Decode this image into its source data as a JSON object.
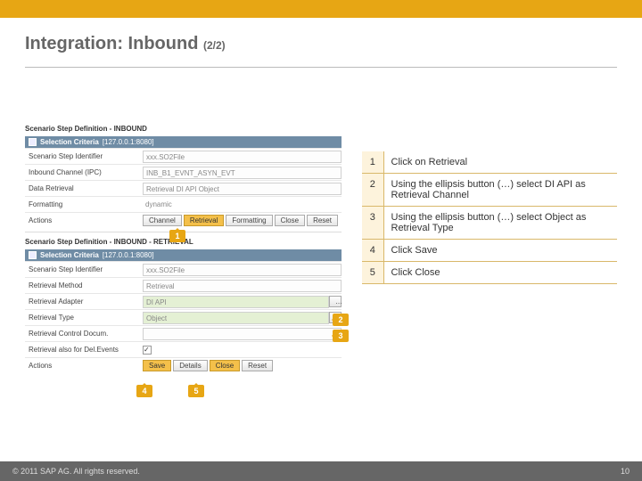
{
  "title_main": "Integration: Inbound",
  "title_sub": "(2/2)",
  "panel1": {
    "head": "Scenario Step Definition - INBOUND",
    "sel_label": "Selection Criteria",
    "sel_ip": "[127.0.0.1:8080]",
    "r_identifier_lbl": "Scenario Step Identifier",
    "r_identifier_val": "xxx.SO2File",
    "r_channel_lbl": "Inbound Channel (IPC)",
    "r_channel_val": "INB_B1_EVNT_ASYN_EVT",
    "r_retrieval_lbl": "Data Retrieval",
    "r_retrieval_val": "Retrieval DI API Object",
    "r_format_lbl": "Formatting",
    "r_format_val": "dynamic",
    "actions_lbl": "Actions",
    "btn_channel": "Channel",
    "btn_retrieval": "Retrieval",
    "btn_formatting": "Formatting",
    "btn_close": "Close",
    "btn_reset": "Reset"
  },
  "panel2": {
    "head": "Scenario Step Definition - INBOUND - RETRIEVAL",
    "sel_label": "Selection Criteria",
    "sel_ip": "[127.0.0.1:8080]",
    "r_identifier_lbl": "Scenario Step Identifier",
    "r_identifier_val": "xxx.SO2File",
    "r_method_lbl": "Retrieval Method",
    "r_method_val": "Retrieval",
    "r_adapter_lbl": "Retrieval Adapter",
    "r_adapter_val": "DI API",
    "r_type_lbl": "Retrieval Type",
    "r_type_val": "Object",
    "r_conf_lbl": "Retrieval Control Docum.",
    "r_del_lbl": "Retrieval also for Del.Events",
    "actions_lbl": "Actions",
    "btn_save": "Save",
    "btn_details": "Details",
    "btn_close": "Close",
    "btn_reset": "Reset"
  },
  "call1": "1",
  "call2": "2",
  "call3": "3",
  "call4": "4",
  "call5": "5",
  "steps": [
    {
      "n": "1",
      "t": "Click on Retrieval"
    },
    {
      "n": "2",
      "t": "Using the ellipsis button (…) select DI API as Retrieval Channel"
    },
    {
      "n": "3",
      "t": "Using the ellipsis button (…) select Object as Retrieval Type"
    },
    {
      "n": "4",
      "t": "Click Save"
    },
    {
      "n": "5",
      "t": "Click Close"
    }
  ],
  "footer_left": "© 2011 SAP AG. All rights reserved.",
  "footer_right": "10"
}
